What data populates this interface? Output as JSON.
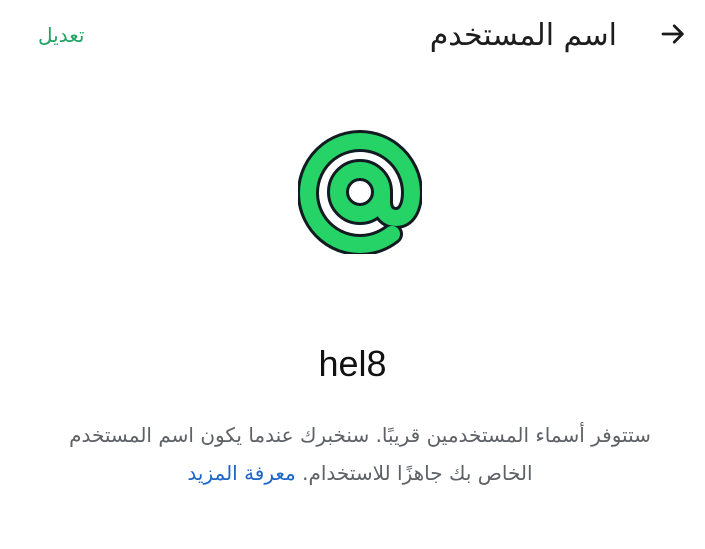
{
  "header": {
    "back_icon": "arrow-right-icon",
    "title": "اسم المستخدم",
    "edit_label": "تعديل"
  },
  "main": {
    "icon": "at-sign-icon",
    "username": "hel8",
    "description_line1": "ستتوفر أسماء المستخدمين قريبًا. سنخبرك عندما يكون اسم المستخدم",
    "description_line2": "الخاص بك جاهزًا للاستخدام.",
    "learn_more_label": "معرفة المزيد"
  },
  "colors": {
    "accent_green": "#21a366",
    "icon_green": "#25d366",
    "link_blue": "#1c65c9"
  }
}
